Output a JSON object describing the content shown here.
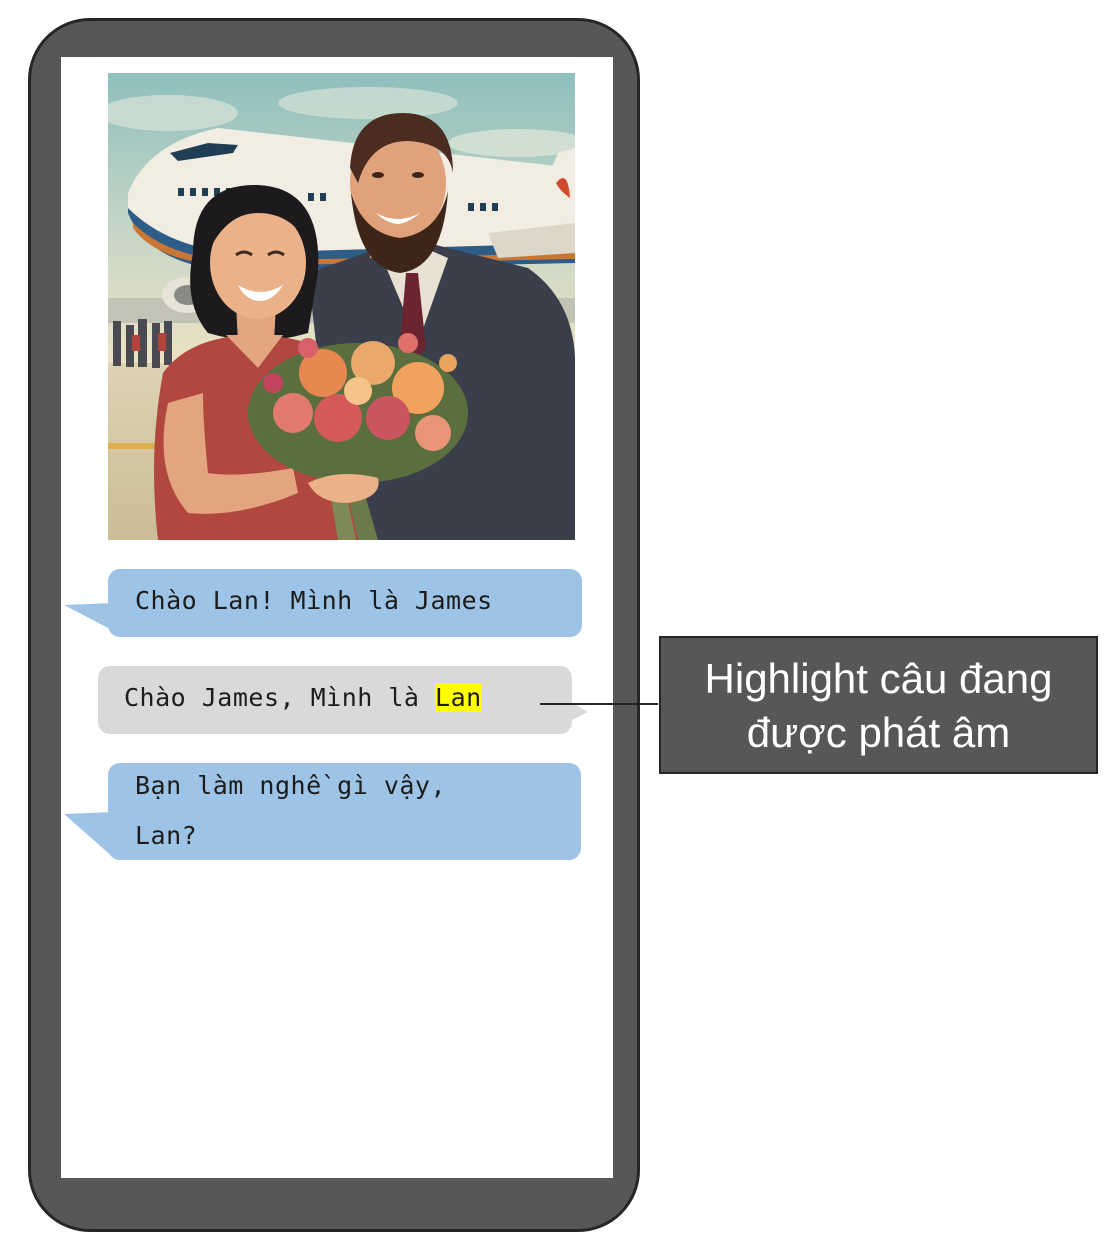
{
  "chat": {
    "messages": [
      {
        "sender": "James",
        "text": "Chào Lan! Mình là James"
      },
      {
        "sender": "Lan",
        "text_before_highlight": "Chào James, Mình là ",
        "highlighted_word": "Lan"
      },
      {
        "sender": "James",
        "line1": "Bạn làm nghề gì vậy,",
        "line2": "Lan?"
      }
    ]
  },
  "annotation": {
    "line1": "Highlight câu đang",
    "line2": "được phát âm"
  },
  "illustration": {
    "subject": "woman-holding-flower-bouquet-with-bearded-man-in-front-of-airplane"
  },
  "colors": {
    "phone_frame": "#575757",
    "bubble_blue": "#9dc3e6",
    "bubble_gray": "#d9d9d9",
    "highlight": "#ffff00",
    "callout_bg": "#575757"
  }
}
